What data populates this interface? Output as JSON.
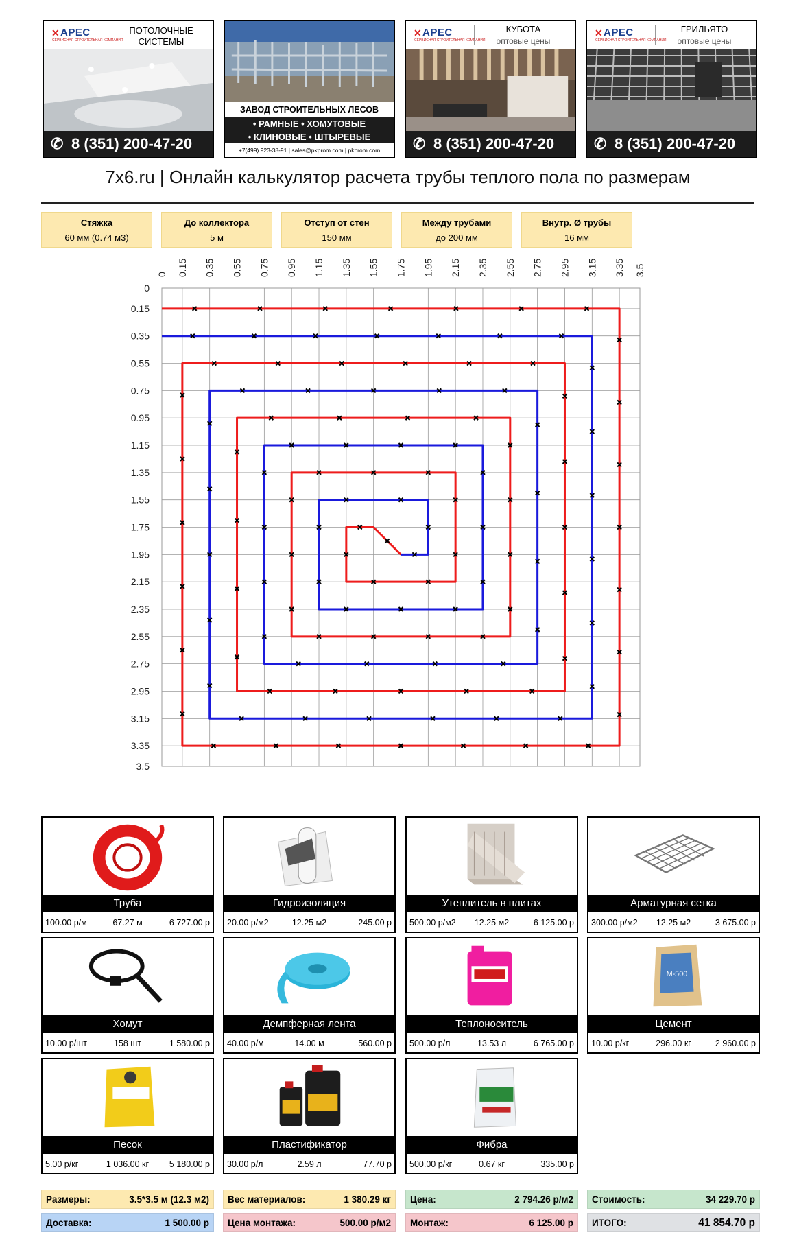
{
  "banners": [
    {
      "brand": "АРЕС",
      "title": "ПОТОЛОЧНЫЕ СИСТЕМЫ",
      "subtitle": "",
      "phone": "8 (351) 200-47-20"
    },
    {
      "title": "ЗАВОД СТРОИТЕЛЬНЫХ ЛЕСОВ",
      "line1": "• РАМНЫЕ  • ХОМУТОВЫЕ",
      "line2": "• КЛИНОВЫЕ  • ШТЫРЕВЫЕ",
      "contacts": "+7(499) 923-38-91 | sales@pkprom.com | pkprom.com"
    },
    {
      "brand": "АРЕС",
      "title": "КУБОТА",
      "subtitle": "оптовые цены",
      "phone": "8 (351) 200-47-20"
    },
    {
      "brand": "АРЕС",
      "title": "ГРИЛЬЯТО",
      "subtitle": "оптовые цены",
      "phone": "8 (351) 200-47-20"
    }
  ],
  "page_title": "7x6.ru | Онлайн калькулятор расчета трубы теплого пола по размерам",
  "params": [
    {
      "label": "Стяжка",
      "value": "60 мм (0.74 м3)"
    },
    {
      "label": "До коллектора",
      "value": "5 м"
    },
    {
      "label": "Отступ от стен",
      "value": "150 мм"
    },
    {
      "label": "Между трубами",
      "value": "до 200 мм"
    },
    {
      "label": "Внутр. Ø трубы",
      "value": "16 мм"
    }
  ],
  "chart_data": {
    "type": "line",
    "title": "",
    "xlabel": "",
    "ylabel": "",
    "xlim": [
      0,
      3.5
    ],
    "ylim": [
      0,
      3.5
    ],
    "y_inverted": true,
    "x_axis_position": "top",
    "grid": true,
    "ticks": [
      "0",
      "0.15",
      "0.35",
      "0.55",
      "0.75",
      "0.95",
      "1.15",
      "1.35",
      "1.55",
      "1.75",
      "1.95",
      "2.15",
      "2.35",
      "2.55",
      "2.75",
      "2.95",
      "3.15",
      "3.35",
      "3.5"
    ],
    "colors": {
      "supply": "#ee1c1c",
      "return": "#1a1adc",
      "grid": "#9a9a9a",
      "marker": "#000000"
    },
    "series": [
      {
        "color": "supply",
        "points": [
          [
            0,
            0.15
          ],
          [
            3.35,
            0.15
          ],
          [
            3.35,
            3.35
          ],
          [
            0.15,
            3.35
          ],
          [
            0.15,
            0.55
          ],
          [
            2.95,
            0.55
          ],
          [
            2.95,
            2.95
          ],
          [
            0.55,
            2.95
          ],
          [
            0.55,
            0.95
          ],
          [
            2.55,
            0.95
          ],
          [
            2.55,
            2.55
          ],
          [
            0.95,
            2.55
          ],
          [
            0.95,
            1.35
          ],
          [
            2.15,
            1.35
          ],
          [
            2.15,
            2.15
          ],
          [
            1.35,
            2.15
          ],
          [
            1.35,
            1.75
          ],
          [
            1.55,
            1.75
          ],
          [
            1.75,
            1.95
          ]
        ]
      },
      {
        "color": "return",
        "points": [
          [
            0,
            0.35
          ],
          [
            3.15,
            0.35
          ],
          [
            3.15,
            3.15
          ],
          [
            0.35,
            3.15
          ],
          [
            0.35,
            0.75
          ],
          [
            2.75,
            0.75
          ],
          [
            2.75,
            2.75
          ],
          [
            0.75,
            2.75
          ],
          [
            0.75,
            1.15
          ],
          [
            2.35,
            1.15
          ],
          [
            2.35,
            2.35
          ],
          [
            1.15,
            2.35
          ],
          [
            1.15,
            1.55
          ],
          [
            1.95,
            1.55
          ],
          [
            1.95,
            1.95
          ],
          [
            1.75,
            1.95
          ]
        ]
      }
    ]
  },
  "materials": [
    {
      "name": "Труба",
      "price": "100.00 р/м",
      "qty": "67.27 м",
      "cost": "6 727.00 р",
      "icon": "pipe-coil-icon"
    },
    {
      "name": "Гидроизоляция",
      "price": "20.00 р/м2",
      "qty": "12.25 м2",
      "cost": "245.00 р",
      "icon": "waterproofing-roll-icon"
    },
    {
      "name": "Утеплитель в плитах",
      "price": "500.00 р/м2",
      "qty": "12.25 м2",
      "cost": "6 125.00 р",
      "icon": "insulation-boards-icon"
    },
    {
      "name": "Арматурная сетка",
      "price": "300.00 р/м2",
      "qty": "12.25 м2",
      "cost": "3 675.00 р",
      "icon": "rebar-mesh-icon"
    },
    {
      "name": "Хомут",
      "price": "10.00 р/шт",
      "qty": "158 шт",
      "cost": "1 580.00 р",
      "icon": "cable-tie-icon"
    },
    {
      "name": "Демпферная лента",
      "price": "40.00 р/м",
      "qty": "14.00 м",
      "cost": "560.00 р",
      "icon": "damper-tape-icon"
    },
    {
      "name": "Теплоноситель",
      "price": "500.00 р/л",
      "qty": "13.53 л",
      "cost": "6 765.00 р",
      "icon": "coolant-canister-icon"
    },
    {
      "name": "Цемент",
      "price": "10.00 р/кг",
      "qty": "296.00 кг",
      "cost": "2 960.00 р",
      "icon": "cement-bag-icon"
    },
    {
      "name": "Песок",
      "price": "5.00 р/кг",
      "qty": "1 036.00 кг",
      "cost": "5 180.00 р",
      "icon": "sand-bag-icon"
    },
    {
      "name": "Пластификатор",
      "price": "30.00 р/л",
      "qty": "2.59 л",
      "cost": "77.70 р",
      "icon": "plasticizer-canister-icon"
    },
    {
      "name": "Фибра",
      "price": "500.00 р/кг",
      "qty": "0.67 кг",
      "cost": "335.00 р",
      "icon": "fiber-bag-icon"
    }
  ],
  "summary": [
    {
      "label": "Размеры:",
      "value": "3.5*3.5 м (12.3 м2)",
      "bg": "#fde9b0"
    },
    {
      "label": "Вес материалов:",
      "value": "1 380.29 кг",
      "bg": "#fde9b0"
    },
    {
      "label": "Цена:",
      "value": "2 794.26 р/м2",
      "bg": "#c6e6cc"
    },
    {
      "label": "Стоимость:",
      "value": "34 229.70 р",
      "bg": "#c6e6cc"
    },
    {
      "label": "Доставка:",
      "value": "1 500.00 р",
      "bg": "#b8d4f5"
    },
    {
      "label": "Цена монтажа:",
      "value": "500.00 р/м2",
      "bg": "#f5c6cb"
    },
    {
      "label": "Монтаж:",
      "value": "6 125.00 р",
      "bg": "#f5c6cb"
    },
    {
      "label": "ИТОГО:",
      "value": "41 854.70 р",
      "bg": "#dfe1e4"
    }
  ]
}
